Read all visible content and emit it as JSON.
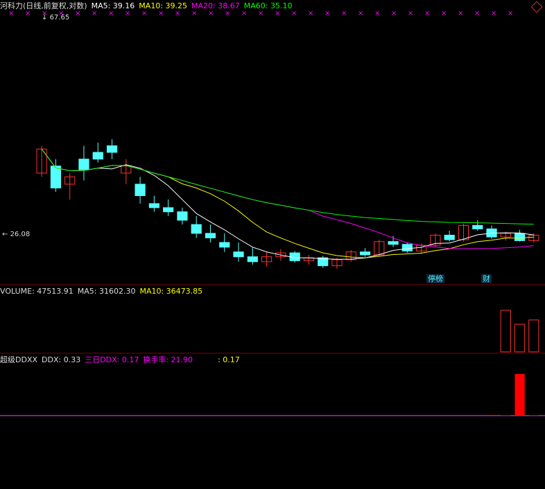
{
  "header": {
    "title": "河科力(日线,前复权,对数)",
    "ma5": "MA5: 39.16",
    "ma10": "MA10: 39.25",
    "ma20": "MA20: 38.67",
    "ma60": "MA60: 35.10"
  },
  "volume_header": {
    "label": "VOLUME: 47513.91",
    "ma5": "MA5: 31602.30",
    "ma10": "MA10: 36473.85"
  },
  "ddx_header": {
    "title": "超级DDXX",
    "ddx": "DDX: 0.33",
    "ddx3": "三日DDX: 0.17",
    "turnover": "换手率: 21.90",
    "extra": ": 0.17"
  },
  "markers": {
    "high_label": "67.65",
    "low_label": "26.08",
    "stop_tag": "停榜",
    "finance_tag": "财",
    "top_marks": [
      "×",
      "×",
      "×",
      "×",
      "×",
      "×",
      "×",
      "×",
      "×",
      "×",
      "×",
      "×",
      "×",
      "×",
      "×",
      "×",
      "×",
      "×",
      "×",
      "×",
      "×",
      "×",
      "×",
      "×",
      "×",
      "×",
      "×",
      "×",
      "×",
      "×",
      "×"
    ]
  },
  "colors": {
    "up": "#ff3232",
    "down": "#54ffff",
    "ma5": "#ffffff",
    "ma10": "#ffff00",
    "ma20": "#ff00ff",
    "ma60": "#00ff00",
    "ddx_pos": "#ff0000",
    "ddx_neg": "#00ff00",
    "ddx3": "#ffff00",
    "grid": "#800000",
    "cross": "#ff40ff"
  },
  "chart_data": [
    {
      "type": "candlestick",
      "ohlc": [
        [
          38.0,
          42.0,
          37.5,
          41.5
        ],
        [
          39.0,
          40.0,
          35.5,
          36.0
        ],
        [
          36.5,
          38.0,
          34.5,
          37.5
        ],
        [
          40.0,
          42.0,
          37.0,
          38.5
        ],
        [
          41.0,
          42.5,
          39.5,
          40.0
        ],
        [
          42.0,
          43.0,
          40.0,
          41.0
        ],
        [
          38.0,
          40.0,
          36.5,
          39.0
        ],
        [
          36.5,
          37.5,
          34.0,
          35.0
        ],
        [
          34.0,
          35.0,
          33.0,
          33.5
        ],
        [
          33.5,
          34.5,
          32.5,
          33.0
        ],
        [
          33.0,
          33.5,
          31.5,
          32.0
        ],
        [
          31.5,
          32.5,
          30.0,
          30.5
        ],
        [
          30.5,
          31.5,
          29.5,
          30.0
        ],
        [
          29.5,
          30.5,
          28.5,
          29.0
        ],
        [
          28.5,
          29.5,
          27.5,
          28.0
        ],
        [
          28.0,
          29.0,
          27.2,
          27.5
        ],
        [
          27.5,
          28.5,
          27.0,
          28.0
        ],
        [
          28.0,
          28.8,
          27.6,
          28.4
        ],
        [
          28.4,
          28.6,
          27.4,
          27.6
        ],
        [
          27.6,
          28.2,
          27.2,
          27.9
        ],
        [
          27.9,
          28.1,
          26.9,
          27.1
        ],
        [
          27.1,
          27.9,
          26.8,
          27.7
        ],
        [
          27.7,
          28.7,
          27.5,
          28.5
        ],
        [
          28.5,
          28.9,
          28.0,
          28.2
        ],
        [
          28.2,
          29.8,
          28.0,
          29.6
        ],
        [
          29.6,
          30.2,
          29.0,
          29.3
        ],
        [
          29.3,
          29.5,
          28.4,
          28.6
        ],
        [
          28.6,
          29.4,
          28.3,
          29.2
        ],
        [
          29.2,
          30.5,
          29.0,
          30.3
        ],
        [
          30.3,
          30.8,
          29.6,
          29.8
        ],
        [
          29.8,
          31.6,
          29.6,
          31.4
        ],
        [
          31.4,
          32.0,
          30.8,
          31.0
        ],
        [
          31.0,
          31.4,
          29.9,
          30.1
        ],
        [
          30.1,
          30.7,
          29.7,
          30.5
        ],
        [
          30.5,
          30.9,
          29.6,
          29.7
        ],
        [
          29.7,
          30.5,
          29.5,
          30.3
        ]
      ]
    },
    {
      "type": "bar",
      "name": "VOLUME",
      "values": [
        47513.91,
        31602.3,
        36473.85
      ]
    },
    {
      "type": "bar",
      "name": "DDX",
      "values": [
        0.33,
        0.17,
        21.9,
        0.17
      ]
    }
  ]
}
